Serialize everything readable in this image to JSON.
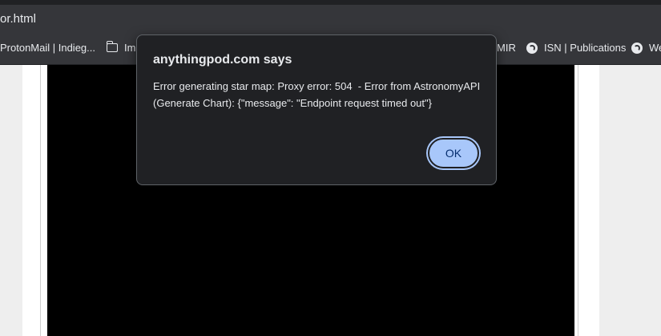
{
  "browser": {
    "address": "or.html",
    "bookmarks": [
      {
        "label": "ProtonMail | Indieg...",
        "icon": "none"
      },
      {
        "label": "Im",
        "icon": "folder-icon"
      },
      {
        "label": "MIR",
        "icon": "none"
      },
      {
        "label": "ISN | Publications",
        "icon": "globe-icon"
      },
      {
        "label": "We",
        "icon": "globe-icon"
      }
    ]
  },
  "dialog": {
    "title": "anythingpod.com says",
    "message": "Error generating star map: Proxy error: 504  - Error from AstronomyAPI\n(Generate Chart): {\"message\": \"Endpoint request timed out\"}",
    "ok_label": "OK"
  },
  "colors": {
    "dialog_bg": "#202124",
    "button_bg": "#a8c7fa",
    "button_text": "#062e6f",
    "star_map_bg": "#000000"
  }
}
